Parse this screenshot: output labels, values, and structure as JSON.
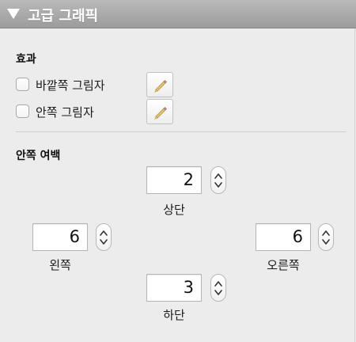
{
  "header": {
    "title": "고급 그래픽",
    "icon": "disclosure-triangle-icon"
  },
  "effects": {
    "title": "효과",
    "items": [
      {
        "label": "바깥쪽 그림자",
        "checked": false,
        "edit_icon": "pencil-icon"
      },
      {
        "label": "안쪽 그림자",
        "checked": false,
        "edit_icon": "pencil-icon"
      }
    ]
  },
  "inner_margin": {
    "title": "안쪽 여백",
    "top": {
      "label": "상단",
      "value": "2"
    },
    "left": {
      "label": "왼쪽",
      "value": "6"
    },
    "right": {
      "label": "오른쪽",
      "value": "6"
    },
    "bottom": {
      "label": "하단",
      "value": "3"
    }
  },
  "colors": {
    "header_bg": "#a8a8a8",
    "panel_bg": "#ececec"
  }
}
